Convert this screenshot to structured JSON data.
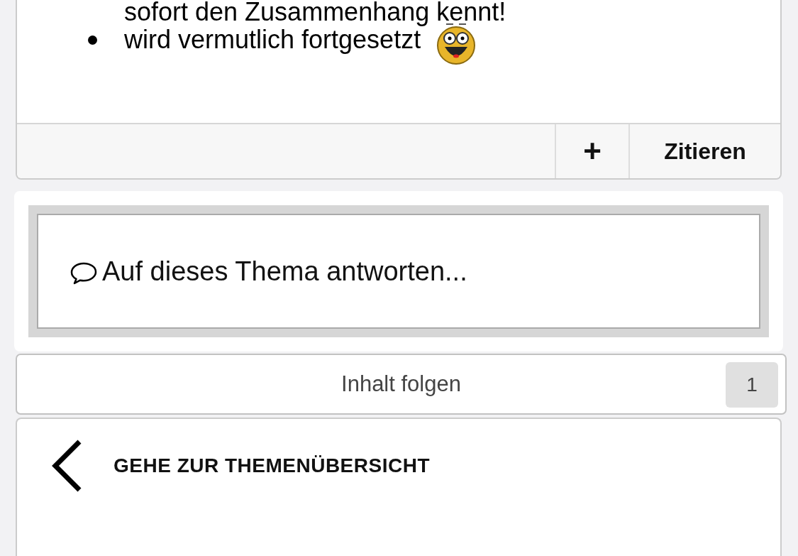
{
  "post": {
    "list_items": [
      {
        "text": "sofort den Zusammenhang kennt!",
        "emoji": false
      },
      {
        "text": "wird vermutlich fortgesetzt",
        "emoji": true
      }
    ],
    "actions": [
      {
        "kind": "icon",
        "label": "+"
      },
      {
        "kind": "text",
        "label": "Zitieren"
      }
    ]
  },
  "reply": {
    "placeholder": "Auf dieses Thema antworten..."
  },
  "follow": {
    "label": "Inhalt folgen",
    "count": "1"
  },
  "navigation": {
    "label": "GEHE ZUR THEMENÜBERSICHT"
  }
}
